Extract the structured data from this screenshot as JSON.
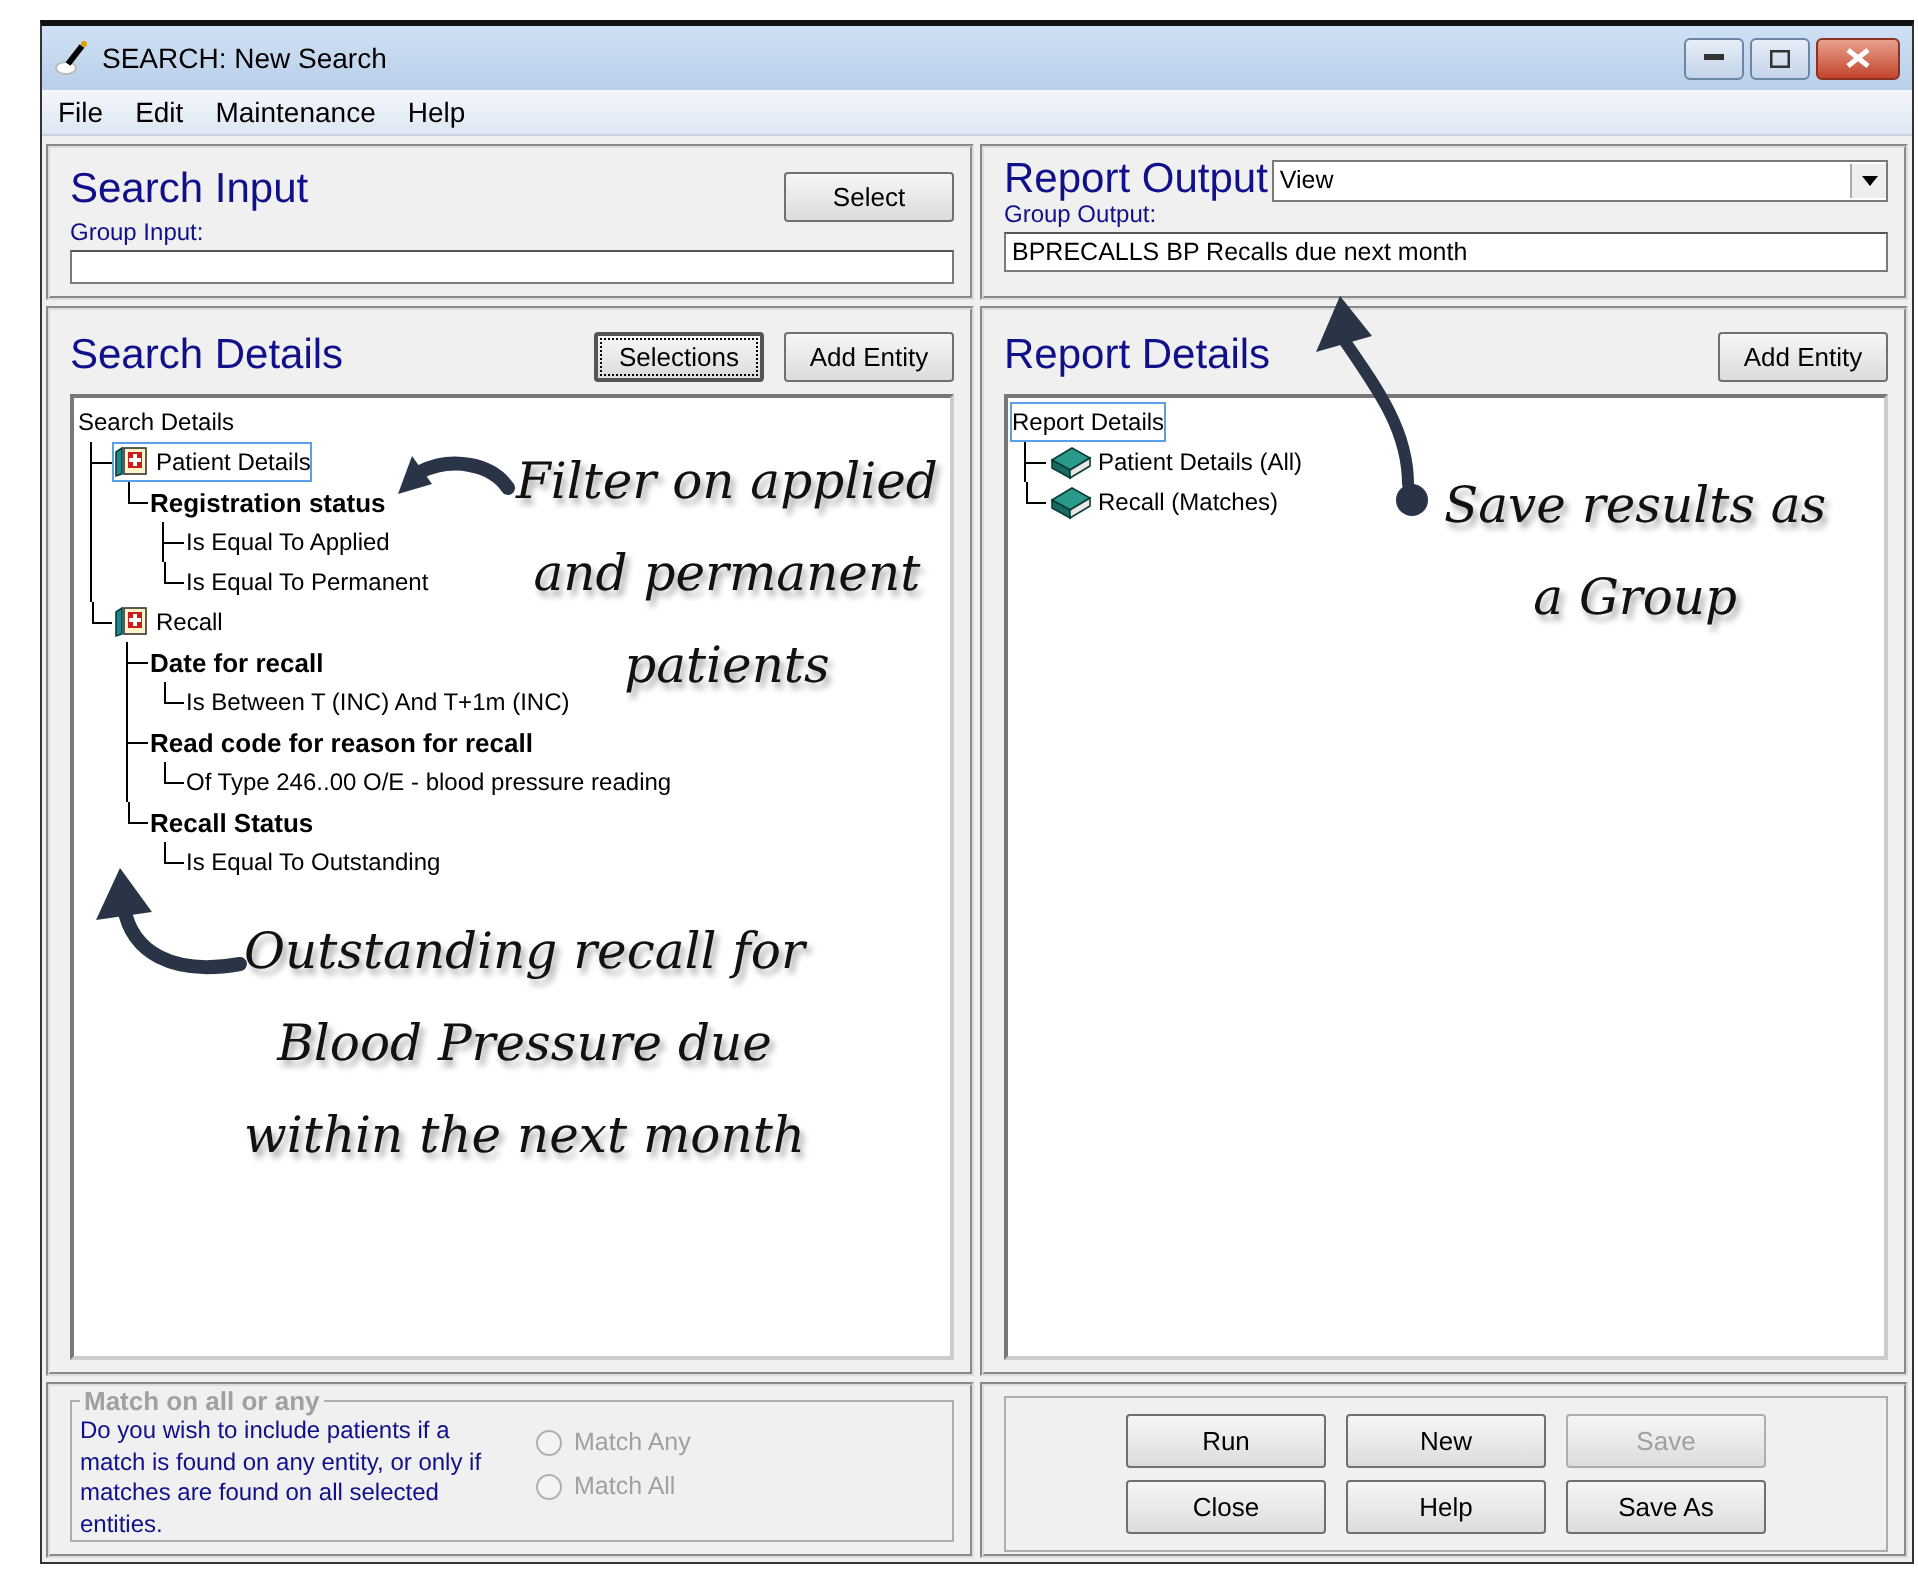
{
  "window": {
    "title": "SEARCH: New Search"
  },
  "menu": [
    "File",
    "Edit",
    "Maintenance",
    "Help"
  ],
  "search_input": {
    "title": "Search Input",
    "label": "Group Input:",
    "button": "Select"
  },
  "report_output": {
    "title": "Report Output",
    "dropdown": "View",
    "label": "Group Output:",
    "value": "BPRECALLS BP Recalls due next month"
  },
  "search_details": {
    "title": "Search Details",
    "buttons": [
      {
        "label": "Selections",
        "focused": true
      },
      {
        "label": "Add Entity",
        "focused": false
      }
    ],
    "tree": {
      "label": "Search Details",
      "selected": false,
      "children": [
        {
          "label": "Patient Details",
          "kind": "entity",
          "selected": true,
          "children": [
            {
              "label": "Registration status",
              "kind": "criterion",
              "selected": false,
              "children": [
                {
                  "label": "Is Equal To Applied",
                  "kind": "value",
                  "selected": false
                },
                {
                  "label": "Is Equal To Permanent",
                  "kind": "value",
                  "selected": false
                }
              ]
            }
          ]
        },
        {
          "label": "Recall",
          "kind": "entity",
          "selected": false,
          "children": [
            {
              "label": "Date for recall",
              "kind": "criterion",
              "selected": false,
              "children": [
                {
                  "label": "Is Between T (INC) And T+1m (INC)",
                  "kind": "value",
                  "selected": false
                }
              ]
            },
            {
              "label": "Read code for reason for recall",
              "kind": "criterion",
              "selected": false,
              "children": [
                {
                  "label": "Of Type 246..00 O/E - blood pressure reading",
                  "kind": "value",
                  "selected": false
                }
              ]
            },
            {
              "label": "Recall Status",
              "kind": "criterion",
              "selected": false,
              "children": [
                {
                  "label": "Is Equal To Outstanding",
                  "kind": "value",
                  "selected": false
                }
              ]
            }
          ]
        }
      ]
    }
  },
  "report_details": {
    "title": "Report Details",
    "buttons": [
      {
        "label": "Add Entity",
        "focused": false
      }
    ],
    "tree": {
      "label": "Report Details",
      "selected": true,
      "children": [
        {
          "label": "Patient Details (All)",
          "kind": "book",
          "selected": false
        },
        {
          "label": "Recall (Matches)",
          "kind": "book",
          "selected": false
        }
      ]
    }
  },
  "match_group": {
    "title": "Match on all or any",
    "text": "Do you wish to include patients if a match is found on any entity, or only if matches are found on all selected entities.",
    "options": [
      {
        "label": "Match Any",
        "selected": false,
        "disabled": true
      },
      {
        "label": "Match All",
        "selected": false,
        "disabled": true
      }
    ]
  },
  "actions": [
    {
      "label": "Run",
      "disabled": false
    },
    {
      "label": "New",
      "disabled": false
    },
    {
      "label": "Save",
      "disabled": true
    },
    {
      "label": "Close",
      "disabled": false
    },
    {
      "label": "Help",
      "disabled": false
    },
    {
      "label": "Save As",
      "disabled": false
    }
  ],
  "annotations": [
    {
      "lines": [
        "Filter on applied",
        "and permanent",
        "patients"
      ]
    },
    {
      "lines": [
        "Save results as",
        "a Group"
      ]
    },
    {
      "lines": [
        "Outstanding recall for",
        "Blood Pressure due",
        "within the next month"
      ]
    }
  ]
}
